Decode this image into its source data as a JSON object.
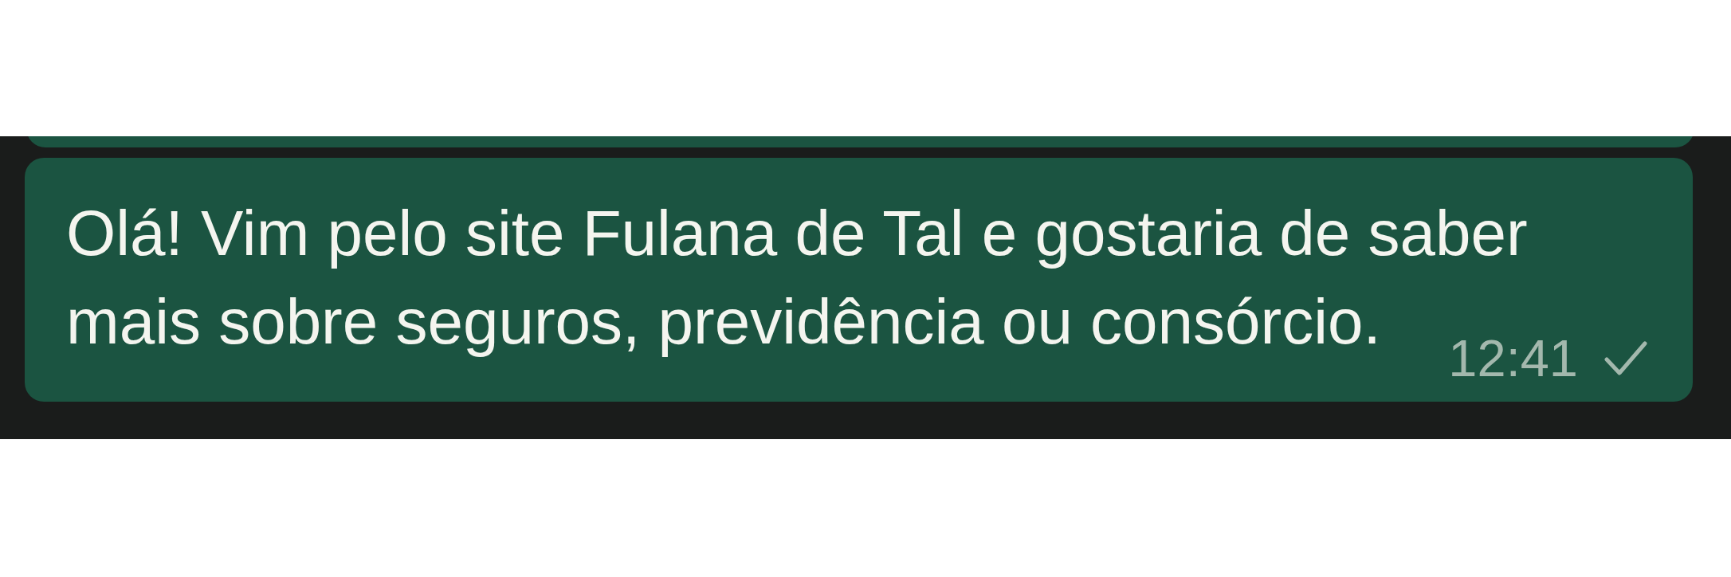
{
  "conversation": {
    "messages": [
      {
        "kind": "clipped",
        "outgoing": true
      },
      {
        "kind": "text",
        "outgoing": true,
        "text": "Olá! Vim pelo site Fulana de Tal e gostaria de saber mais sobre seguros, previdência ou consórcio.",
        "time": "12:41",
        "delivered": false
      }
    ]
  }
}
